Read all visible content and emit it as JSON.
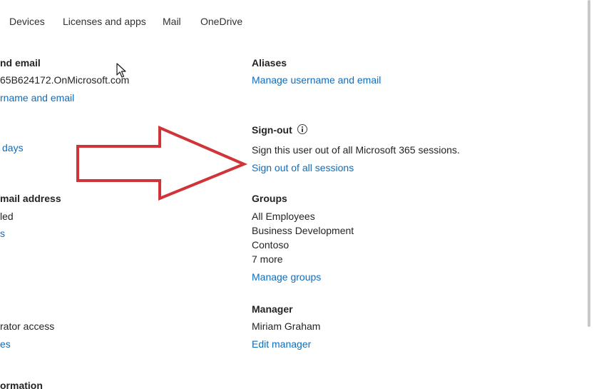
{
  "tabs": [
    {
      "label": "Devices"
    },
    {
      "label": "Licenses and apps"
    },
    {
      "label": "Mail"
    },
    {
      "label": "OneDrive"
    }
  ],
  "left_column": {
    "username": {
      "heading": "nd email",
      "value": "65B624172.OnMicrosoft.com",
      "link": "rname and email"
    },
    "password": {
      "link": "days"
    },
    "contact": {
      "heading": "mail address",
      "value": "led",
      "link": "s"
    },
    "roles": {
      "value": "rator access",
      "link": "es"
    },
    "contact_info": {
      "heading": "ormation"
    }
  },
  "right_column": {
    "aliases": {
      "heading": "Aliases",
      "link": "Manage username and email"
    },
    "signout": {
      "heading": "Sign-out",
      "description": "Sign this user out of all Microsoft 365 sessions.",
      "link": "Sign out of all sessions"
    },
    "groups": {
      "heading": "Groups",
      "items": [
        "All Employees",
        "Business Development",
        "Contoso",
        "7 more"
      ],
      "link": "Manage groups"
    },
    "manager": {
      "heading": "Manager",
      "value": "Miriam Graham",
      "link": "Edit manager"
    }
  },
  "colors": {
    "link": "#0f6cbd",
    "text": "#242424",
    "arrow": "#d13438"
  },
  "icons": {
    "signout_info": "info-icon",
    "annotation": "arrow-right-icon",
    "pointer": "mouse-cursor-icon"
  }
}
